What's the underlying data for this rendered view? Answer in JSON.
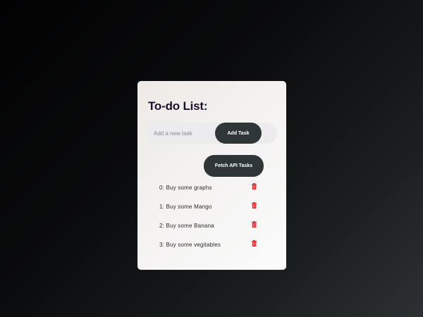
{
  "todo": {
    "title": "To-do List:",
    "input": {
      "placeholder": "Add a new task",
      "value": ""
    },
    "add_button_label": "Add Task",
    "fetch_button_label": "Fetch API Tasks",
    "tasks": [
      {
        "label": "0: Buy some graphs"
      },
      {
        "label": "1: Buy some Mango"
      },
      {
        "label": "2: Buy some Banana"
      },
      {
        "label": "3: Buy some vegitables"
      }
    ],
    "delete_icon": "trash-icon"
  },
  "colors": {
    "background_dark": "#020203",
    "background_light": "#2b3132",
    "card": "#f5f4f3",
    "button": "#2f3637",
    "title": "#1f1030",
    "delete": "#d9262c"
  }
}
